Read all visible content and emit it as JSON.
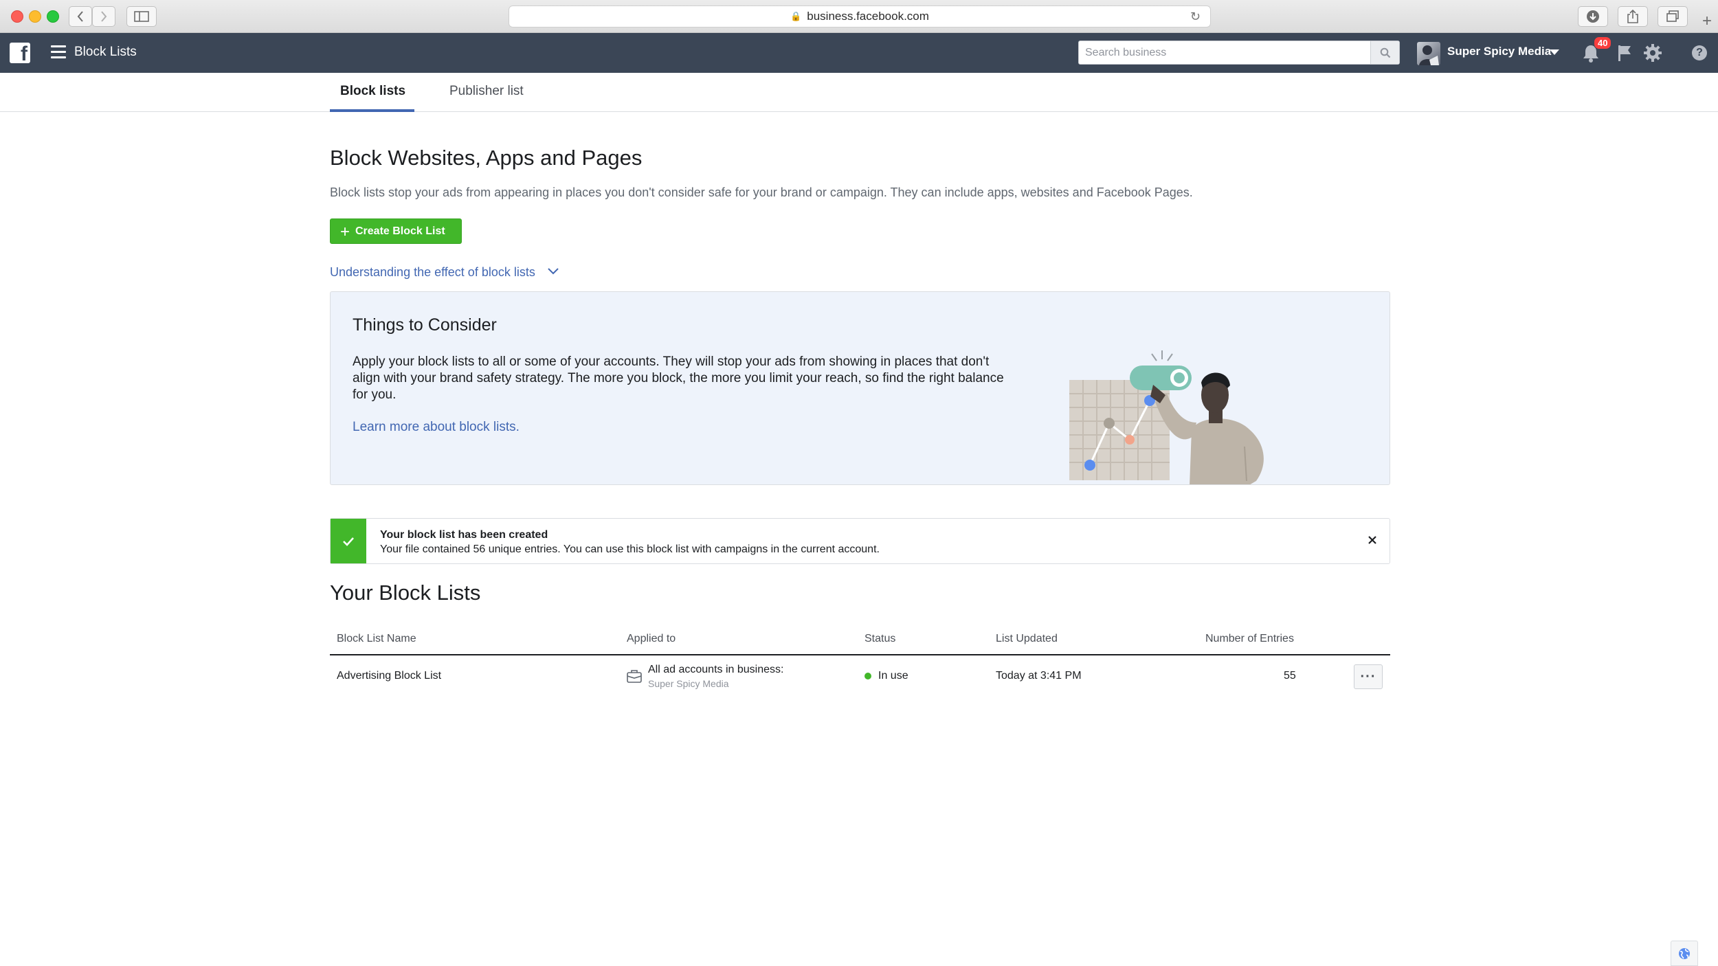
{
  "browser": {
    "url": "business.facebook.com"
  },
  "topbar": {
    "title": "Block Lists",
    "search_placeholder": "Search business",
    "account_name": "Super Spicy Media",
    "notification_count": "40"
  },
  "tabs": [
    {
      "label": "Block lists",
      "active": true
    },
    {
      "label": "Publisher list",
      "active": false
    }
  ],
  "main": {
    "title": "Block Websites, Apps and Pages",
    "description": "Block lists stop your ads from appearing in places you don't consider safe for your brand or campaign. They can include apps, websites and Facebook Pages.",
    "create_button": "Create Block List",
    "understanding_link": "Understanding the effect of block lists"
  },
  "consider": {
    "title": "Things to Consider",
    "body": "Apply your block lists to all or some of your accounts. They will stop your ads from showing in places that don't align with your brand safety strategy. The more you block, the more you limit your reach, so find the right balance for you.",
    "link": "Learn more about block lists."
  },
  "toast": {
    "title": "Your block list has been created",
    "message": "Your file contained 56 unique entries. You can use this block list with campaigns in the current account."
  },
  "lists": {
    "title": "Your Block Lists",
    "columns": [
      "Block List Name",
      "Applied to",
      "Status",
      "List Updated",
      "Number of Entries"
    ],
    "rows": [
      {
        "name": "Advertising Block List",
        "applied_to": "All ad accounts in business:",
        "applied_to_sub": "Super Spicy Media",
        "status": "In use",
        "updated": "Today at 3:41 PM",
        "entries": "55"
      }
    ]
  },
  "colors": {
    "topbar": "#3b4656",
    "accent_blue": "#4267b2",
    "success_green": "#42b72a"
  }
}
